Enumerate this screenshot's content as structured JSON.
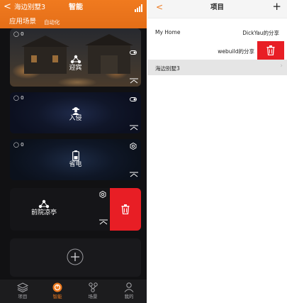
{
  "left_screen": {
    "header": {
      "back_glyph": "<",
      "property_name": "海边别墅3",
      "title": "智能",
      "tabs": [
        {
          "label": "应用场景",
          "active": true
        },
        {
          "label": "自动化",
          "active": false
        }
      ],
      "accent_color": "#EE7A1F"
    },
    "scene_cards": [
      {
        "label": "迎宾",
        "device_count": "0"
      },
      {
        "label": "入侵",
        "device_count": "0"
      },
      {
        "label": "省电",
        "device_count": "0"
      },
      {
        "label": "前院凉亭"
      }
    ],
    "bottom_nav": [
      {
        "label": "项目",
        "icon": "layers-icon",
        "active": false
      },
      {
        "label": "智能",
        "icon": "smart-icon",
        "active": true
      },
      {
        "label": "场景",
        "icon": "scene-icon",
        "active": false
      },
      {
        "label": "我的",
        "icon": "person-icon",
        "active": false
      }
    ],
    "delete_color": "#E81E25"
  },
  "right_screen": {
    "header": {
      "back_glyph": "<",
      "title": "项目",
      "plus_glyph": "+"
    },
    "rows": [
      {
        "name": "My Home",
        "share": "DickYau的分享"
      },
      {
        "share": "webuild的分享"
      },
      {
        "name": "海边别墅3"
      }
    ]
  }
}
